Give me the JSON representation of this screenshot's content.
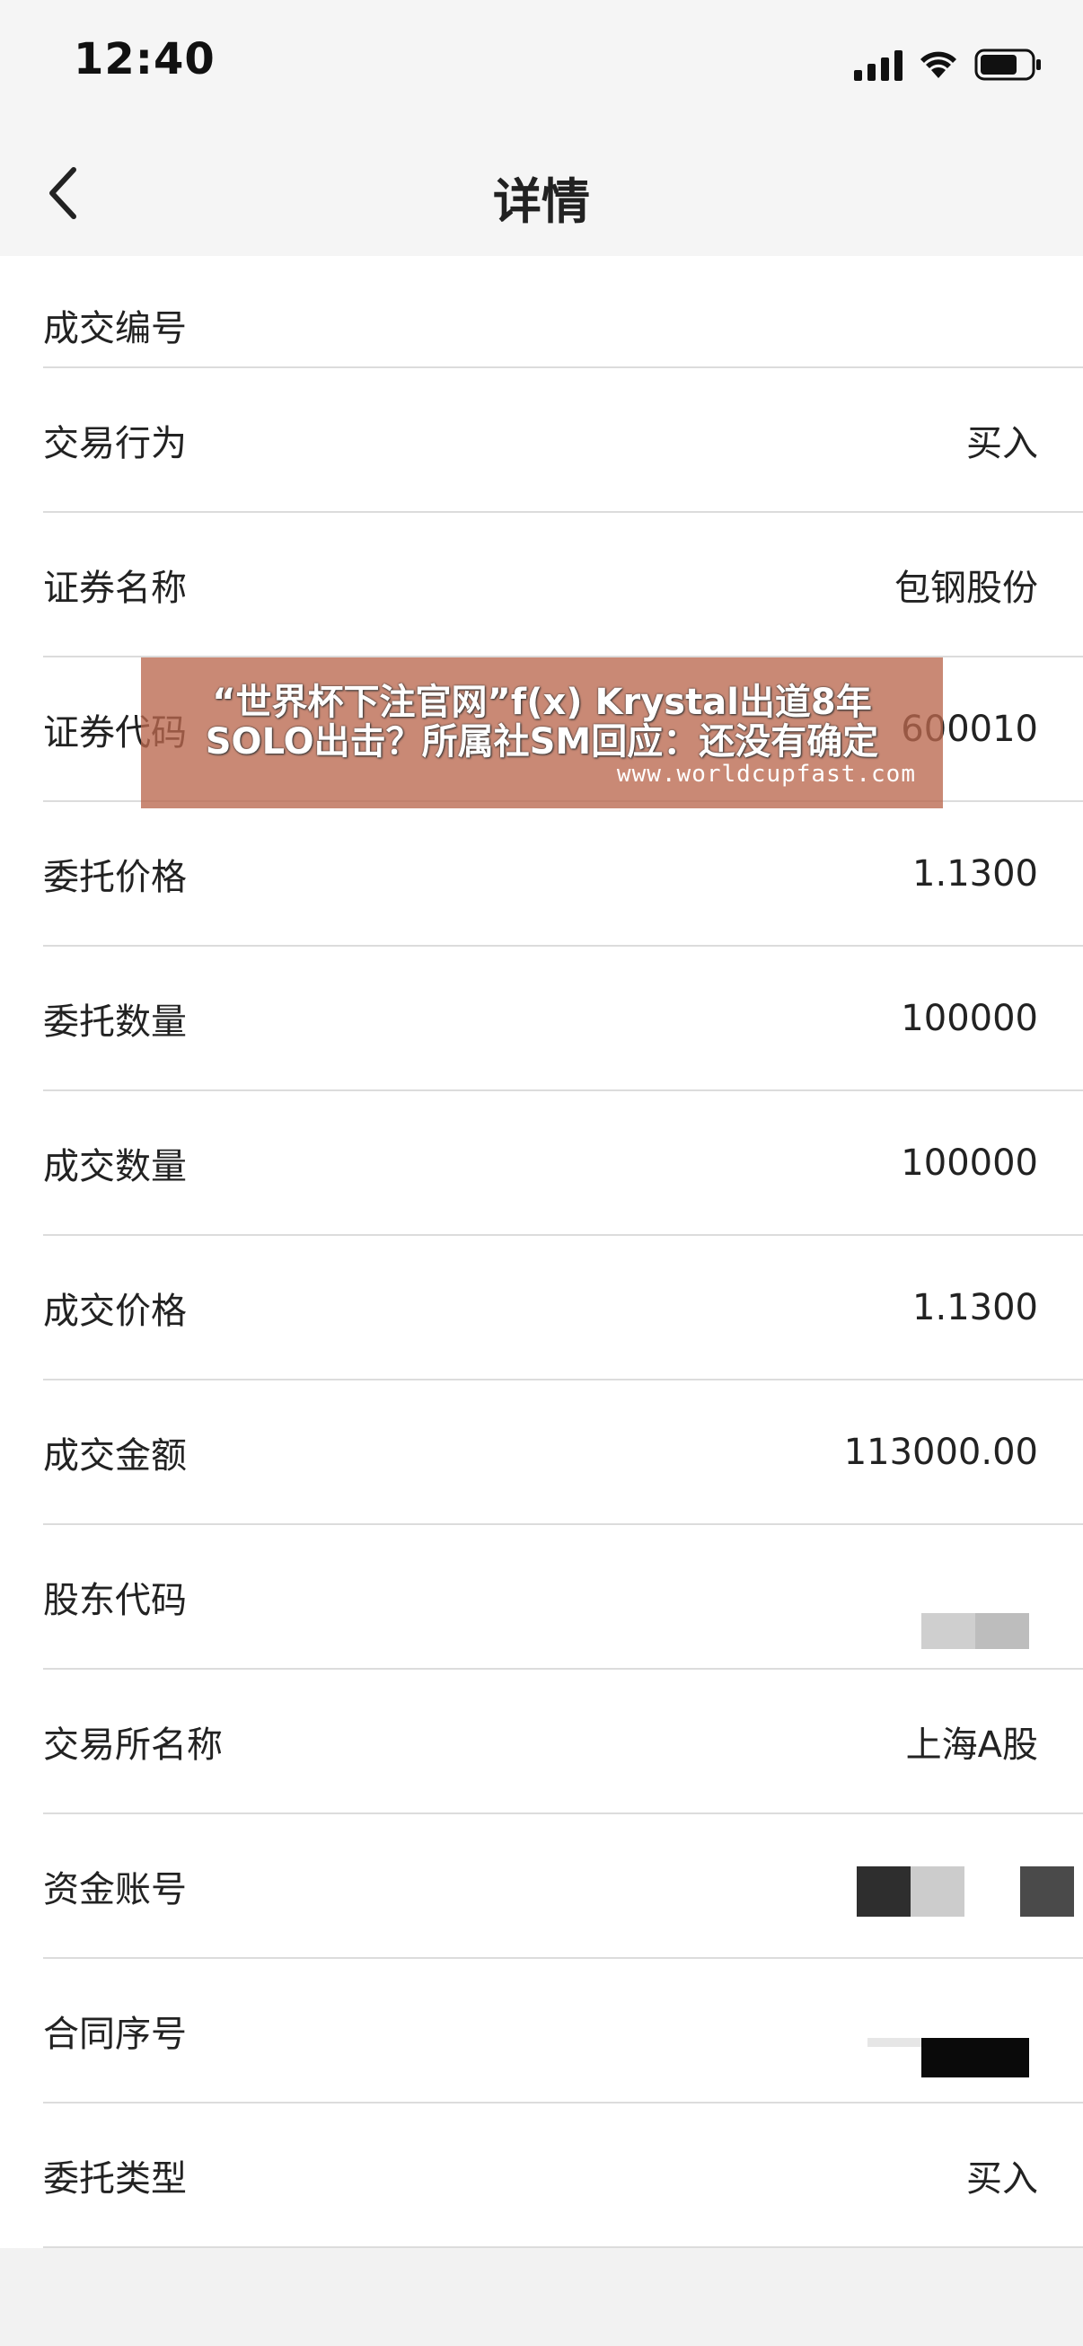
{
  "status_bar": {
    "time": "12:40",
    "icons": [
      "signal-icon",
      "wifi-icon",
      "battery-icon"
    ]
  },
  "nav": {
    "title": "详情",
    "back_icon": "chevron-left-icon"
  },
  "rows": [
    {
      "label": "成交编号",
      "value": ""
    },
    {
      "label": "交易行为",
      "value": "买入"
    },
    {
      "label": "证券名称",
      "value": "包钢股份"
    },
    {
      "label": "证券代码",
      "value": "600010"
    },
    {
      "label": "委托价格",
      "value": "1.1300"
    },
    {
      "label": "委托数量",
      "value": "100000"
    },
    {
      "label": "成交数量",
      "value": "100000"
    },
    {
      "label": "成交价格",
      "value": "1.1300"
    },
    {
      "label": "成交金额",
      "value": "113000.00"
    },
    {
      "label": "股东代码",
      "value": ""
    },
    {
      "label": "交易所名称",
      "value": "上海A股"
    },
    {
      "label": "资金账号",
      "value": ""
    },
    {
      "label": "合同序号",
      "value": ""
    },
    {
      "label": "委托类型",
      "value": "买入"
    }
  ],
  "overlay": {
    "line1": "“世界杯下注官网”f(x) Krystal出道8年",
    "line2": "SOLO出击？所属社SM回应：还没有确定",
    "url": "www.worldcupfast.com"
  },
  "colors": {
    "background": "#f2f2f2",
    "list_bg": "#ffffff",
    "divider": "#dcdcdc",
    "overlay": "#ba684e"
  }
}
